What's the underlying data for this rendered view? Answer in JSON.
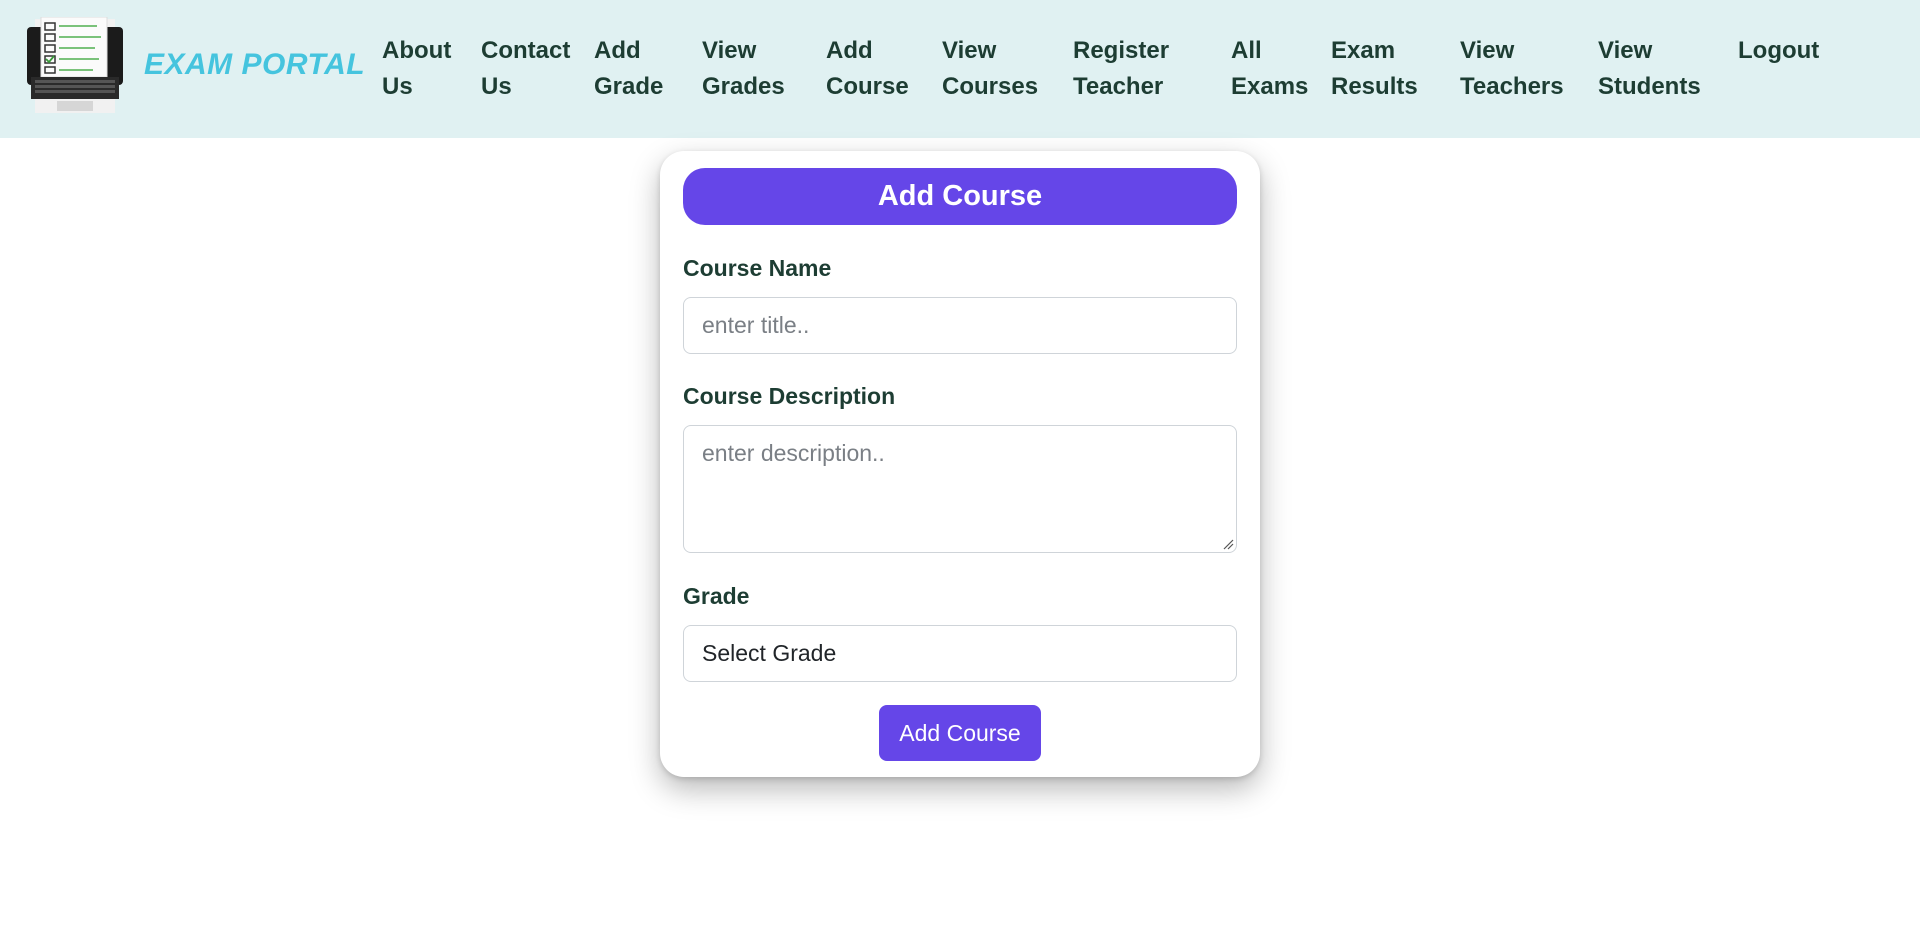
{
  "brand": {
    "name": "EXAM PORTAL",
    "logo_icon": "laptop-checklist-icon",
    "color": "#45c4de"
  },
  "nav": {
    "items": [
      {
        "line1": "About",
        "line2": "Us"
      },
      {
        "line1": "Contact",
        "line2": "Us"
      },
      {
        "line1": "Add",
        "line2": "Grade"
      },
      {
        "line1": "View",
        "line2": "Grades"
      },
      {
        "line1": "Add",
        "line2": "Course"
      },
      {
        "line1": "View",
        "line2": "Courses"
      },
      {
        "line1": "Register",
        "line2": "Teacher"
      },
      {
        "line1": "All",
        "line2": "Exams"
      },
      {
        "line1": "Exam",
        "line2": "Results"
      },
      {
        "line1": "View",
        "line2": "Teachers"
      },
      {
        "line1": "View",
        "line2": "Students"
      },
      {
        "line1": "Logout",
        "line2": ""
      }
    ]
  },
  "form": {
    "title": "Add Course",
    "course_name_label": "Course Name",
    "course_name_placeholder": "enter title..",
    "course_name_value": "",
    "description_label": "Course Description",
    "description_placeholder": "enter description..",
    "description_value": "",
    "grade_label": "Grade",
    "grade_selected": "Select Grade",
    "submit_label": "Add Course"
  },
  "colors": {
    "navbar_bg": "#e0f1f2",
    "accent": "#6546e8",
    "nav_text": "#1d3d33"
  }
}
